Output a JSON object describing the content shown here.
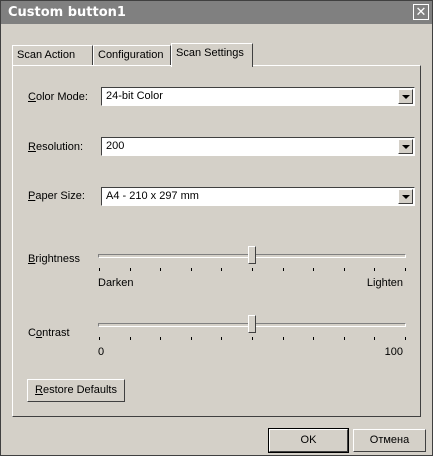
{
  "window": {
    "title": "Custom button1"
  },
  "tabs": [
    {
      "label": "Scan Action"
    },
    {
      "label": "Configuration"
    },
    {
      "label": "Scan Settings",
      "active": true
    }
  ],
  "color_mode": {
    "label_first": "C",
    "label_rest": "olor Mode:",
    "value": "24-bit Color"
  },
  "resolution": {
    "label_first": "R",
    "label_rest": "esolution:",
    "value": "200"
  },
  "paper_size": {
    "label_first": "P",
    "label_rest": "aper Size:",
    "value": "A4 - 210 x 297 mm"
  },
  "brightness": {
    "label_first": "B",
    "label_rest": "rightness",
    "min_label": "Darken",
    "max_label": "Lighten",
    "level": 0.5
  },
  "contrast": {
    "label_pre": "C",
    "label_u": "o",
    "label_rest": "ntrast",
    "min_label": "0",
    "max_label": "100",
    "level": 0.5
  },
  "restore": {
    "label_first": "R",
    "label_rest": "estore Defaults"
  },
  "ok": {
    "label": "OK"
  },
  "cancel": {
    "label": "Отмена"
  }
}
